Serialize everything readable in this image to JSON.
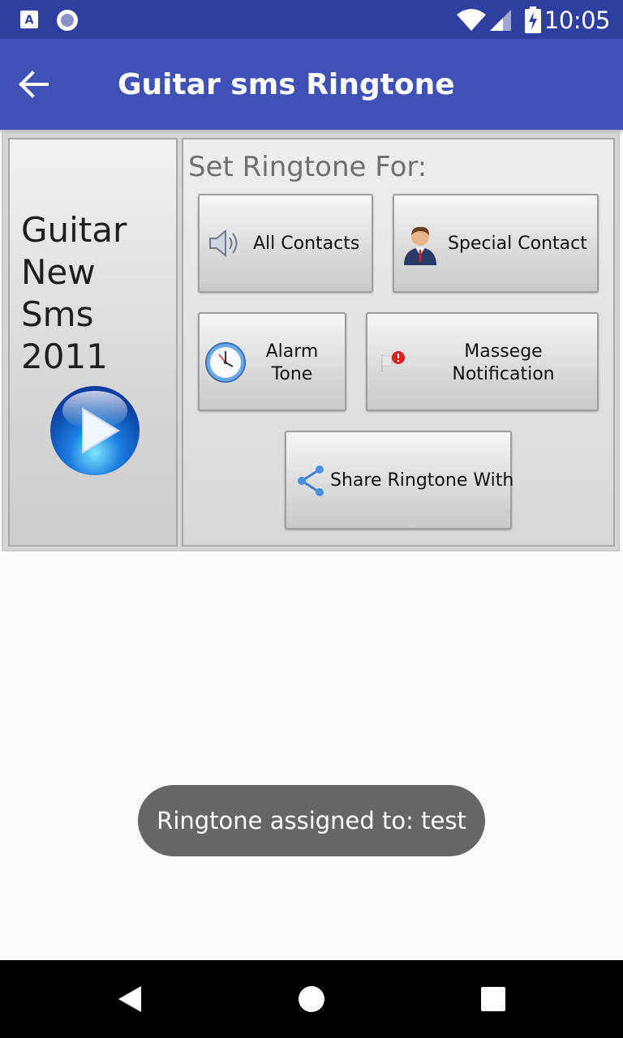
{
  "status_bar": {
    "time": "10:05",
    "icons": [
      "a-notification-icon",
      "circle-notification-icon",
      "wifi-icon",
      "signal-icon",
      "battery-charging-icon"
    ]
  },
  "app_bar": {
    "title": "Guitar sms Ringtone",
    "back_icon": "arrow-back-icon"
  },
  "song": {
    "title": "Guitar\nNew\nSms\n2011",
    "play_icon": "play-icon"
  },
  "ringtone_panel": {
    "heading": "Set Ringtone For:",
    "buttons": {
      "all_contacts": {
        "label": "All Contacts",
        "icon": "speaker-icon"
      },
      "special_contact": {
        "label": "Special Contact",
        "icon": "person-icon"
      },
      "alarm_tone": {
        "label": "Alarm\nTone",
        "icon": "clock-icon"
      },
      "message_notification": {
        "label": "Massege\nNotification",
        "icon": "notification-flag-icon"
      },
      "share": {
        "label": "Share Ringtone With",
        "icon": "share-icon"
      }
    }
  },
  "toast": {
    "text": "Ringtone assigned to: test"
  },
  "nav_bar": {
    "icons": [
      "back-triangle-icon",
      "home-circle-icon",
      "recents-square-icon"
    ]
  },
  "colors": {
    "status_bar": "#2f3fa0",
    "app_bar": "#3f51b5",
    "toast": "#666666",
    "background": "#fafafa"
  }
}
